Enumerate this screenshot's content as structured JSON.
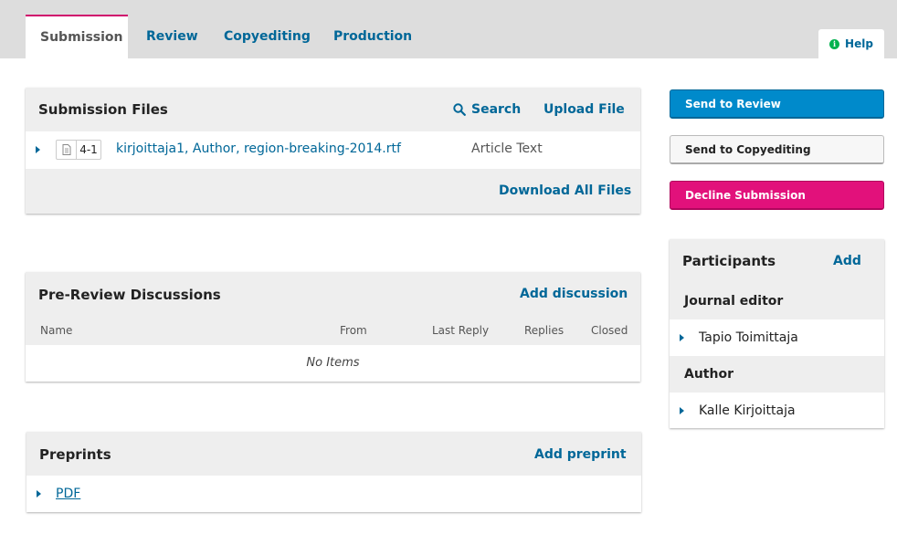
{
  "tabs": [
    {
      "label": "Submission",
      "active": true
    },
    {
      "label": "Review",
      "active": false
    },
    {
      "label": "Copyediting",
      "active": false
    },
    {
      "label": "Production",
      "active": false
    }
  ],
  "help": {
    "label": "Help",
    "icon": "info-icon"
  },
  "submission_files": {
    "title": "Submission Files",
    "search_label": "Search",
    "upload_label": "Upload File",
    "files": [
      {
        "id": "4-1",
        "name": "kirjoittaja1, Author, region-breaking-2014.rtf",
        "type": "Article Text"
      }
    ],
    "download_all_label": "Download All Files"
  },
  "discussions": {
    "title": "Pre-Review Discussions",
    "add_label": "Add discussion",
    "columns": [
      "Name",
      "From",
      "Last Reply",
      "Replies",
      "Closed"
    ],
    "empty_text": "No Items"
  },
  "preprints": {
    "title": "Preprints",
    "add_label": "Add preprint",
    "items": [
      {
        "label": "PDF"
      }
    ]
  },
  "actions": {
    "send_review": "Send to Review",
    "send_copyediting": "Send to Copyediting",
    "decline": "Decline Submission"
  },
  "participants": {
    "title": "Participants",
    "add_label": "Add",
    "groups": [
      {
        "role": "Journal editor",
        "members": [
          "Tapio Toimittaja"
        ]
      },
      {
        "role": "Author",
        "members": [
          "Kalle Kirjoittaja"
        ]
      }
    ]
  },
  "colors": {
    "accent": "#006798",
    "active_tab_border": "#d00a6c",
    "primary": "#008acb",
    "danger": "#e2117b",
    "help_icon": "#00b24e"
  }
}
